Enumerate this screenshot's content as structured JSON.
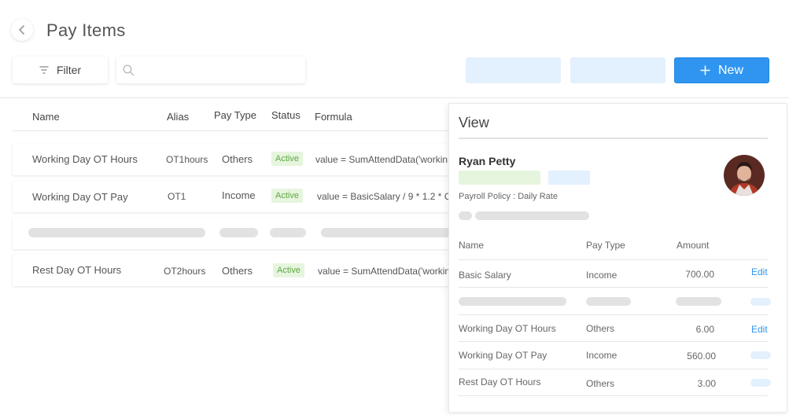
{
  "header": {
    "title": "Pay Items"
  },
  "toolbar": {
    "filter_label": "Filter",
    "search_value": "",
    "new_label": "New"
  },
  "table": {
    "columns": [
      "Name",
      "Alias",
      "Pay Type",
      "Status",
      "Formula"
    ],
    "rows": [
      {
        "name": "Working Day OT Hours",
        "alias": "OT1hours",
        "pay_type": "Others",
        "status": "Active",
        "formula": "value = SumAttendData('workin"
      },
      {
        "name": "Working Day OT Pay",
        "alias": "OT1",
        "pay_type": "Income",
        "status": "Active",
        "formula": "value =  BasicSalary / 9 * 1.2  * C"
      },
      {
        "name": "Rest Day OT Hours",
        "alias": "OT2hours",
        "pay_type": "Others",
        "status": "Active",
        "formula": "value = SumAttendData('workin"
      }
    ]
  },
  "panel": {
    "title": "View",
    "employee_name": "Ryan Petty",
    "policy": "Payroll Policy : Daily Rate",
    "columns": [
      "Name",
      "Pay Type",
      "Amount"
    ],
    "items": [
      {
        "name": "Basic Salary",
        "pay_type": "Income",
        "amount": "700.00",
        "action": "Edit"
      },
      {
        "name": "Working Day OT Hours",
        "pay_type": "Others",
        "amount": "6.00",
        "action": "Edit"
      },
      {
        "name": "Working Day OT Pay",
        "pay_type": "Income",
        "amount": "560.00"
      },
      {
        "name": "Rest Day OT Hours",
        "pay_type": "Others",
        "amount": "3.00"
      }
    ]
  },
  "icons": {
    "back": "chevron-left-icon",
    "filter": "filter-icon",
    "search": "search-icon",
    "add": "plus-icon"
  },
  "colors": {
    "accent": "#2f95f0",
    "status_active_bg": "#e6f5dd",
    "status_active_text": "#5fa745",
    "placeholder_blue": "#e3f0fd"
  }
}
